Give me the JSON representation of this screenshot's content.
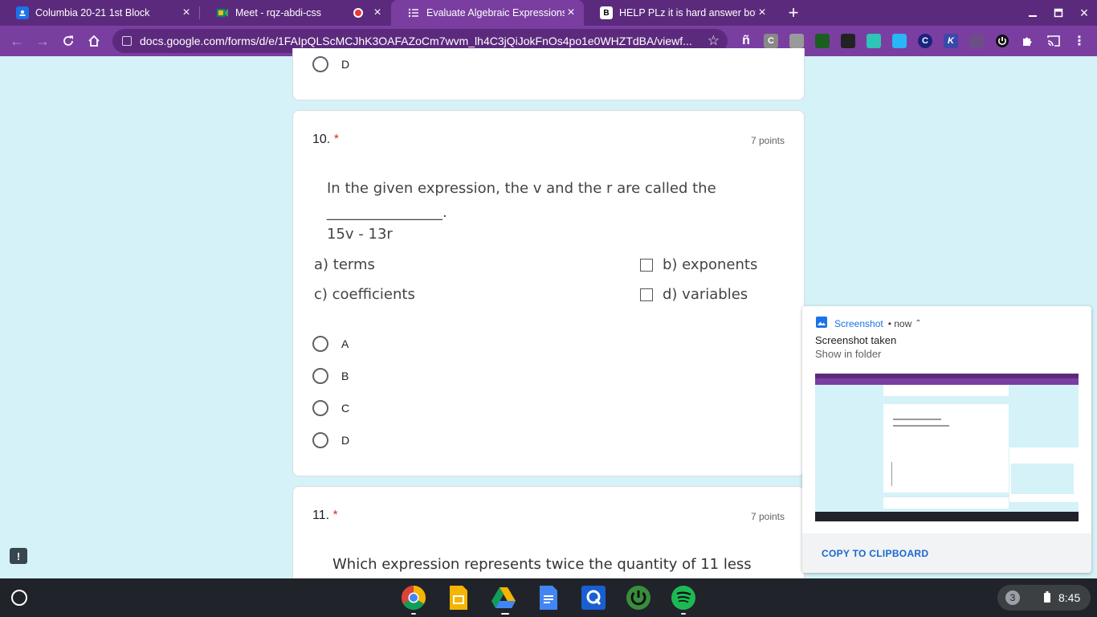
{
  "browser": {
    "tabs": [
      {
        "title": "Columbia 20-21 1st Block",
        "favicon_color": "#1a73e8"
      },
      {
        "title": "Meet - rqz-abdi-css",
        "favicon_color": "#00897b"
      },
      {
        "title": "Evaluate Algebraic Expressions",
        "favicon_color": "#7a3ea1"
      },
      {
        "title": "HELP PLz it is hard answer both",
        "favicon_color": "#000000"
      }
    ],
    "url": "docs.google.com/forms/d/e/1FAIpQLScMCJhK3OAFAZoCm7wvm_lh4C3jQiJokFnOs4po1e0WHZTdBA/viewf...",
    "ext_letter_c": "C",
    "ext_letter_k": "K",
    "ext_letter_n": "ñ"
  },
  "form": {
    "prev_option_d": "D",
    "q10": {
      "number": "10.",
      "required": "*",
      "points": "7 points",
      "prompt_line1": "In the given expression, the v and the r are  called the",
      "blank": "________________.",
      "expression": "15v - 13r",
      "choice_a": "a)  terms",
      "choice_b": "b)  exponents",
      "choice_c": "c)  coefficients",
      "choice_d": "d)  variables",
      "options": [
        "A",
        "B",
        "C",
        "D"
      ]
    },
    "q11": {
      "number": "11.",
      "required": "*",
      "points": "7 points",
      "prompt": "Which expression represents twice the quantity of 11 less"
    }
  },
  "notification": {
    "app": "Screenshot",
    "time": "• now",
    "title": "Screenshot taken",
    "message": "Show in folder",
    "action": "COPY TO CLIPBOARD"
  },
  "shelf": {
    "notification_count": "3",
    "time": "8:45"
  },
  "feedback_label": "!"
}
